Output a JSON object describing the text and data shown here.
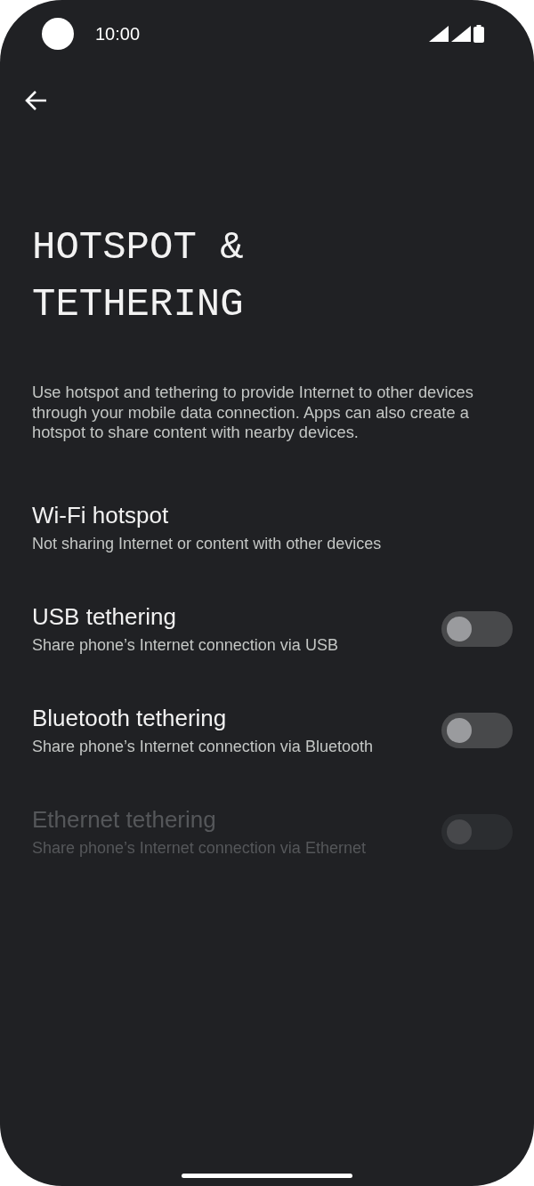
{
  "status_bar": {
    "time": "10:00"
  },
  "title": "HOTSPOT & TETHERING",
  "description": "Use hotspot and tethering to provide Internet to other devices through your mobile data connection. Apps can also create a hotspot to share content with nearby devices.",
  "items": [
    {
      "kind": "link",
      "title": "Wi-Fi hotspot",
      "subtitle": "Not sharing Internet or content with other devices",
      "disabled": false
    },
    {
      "kind": "switch",
      "title": "USB tethering",
      "subtitle": "Share phone’s Internet connection via USB",
      "on": false,
      "disabled": false
    },
    {
      "kind": "switch",
      "title": "Bluetooth tethering",
      "subtitle": "Share phone’s Internet connection via Bluetooth",
      "on": false,
      "disabled": false
    },
    {
      "kind": "switch",
      "title": "Ethernet tethering",
      "subtitle": "Share phone’s Internet connection via Ethernet",
      "on": false,
      "disabled": true
    }
  ]
}
